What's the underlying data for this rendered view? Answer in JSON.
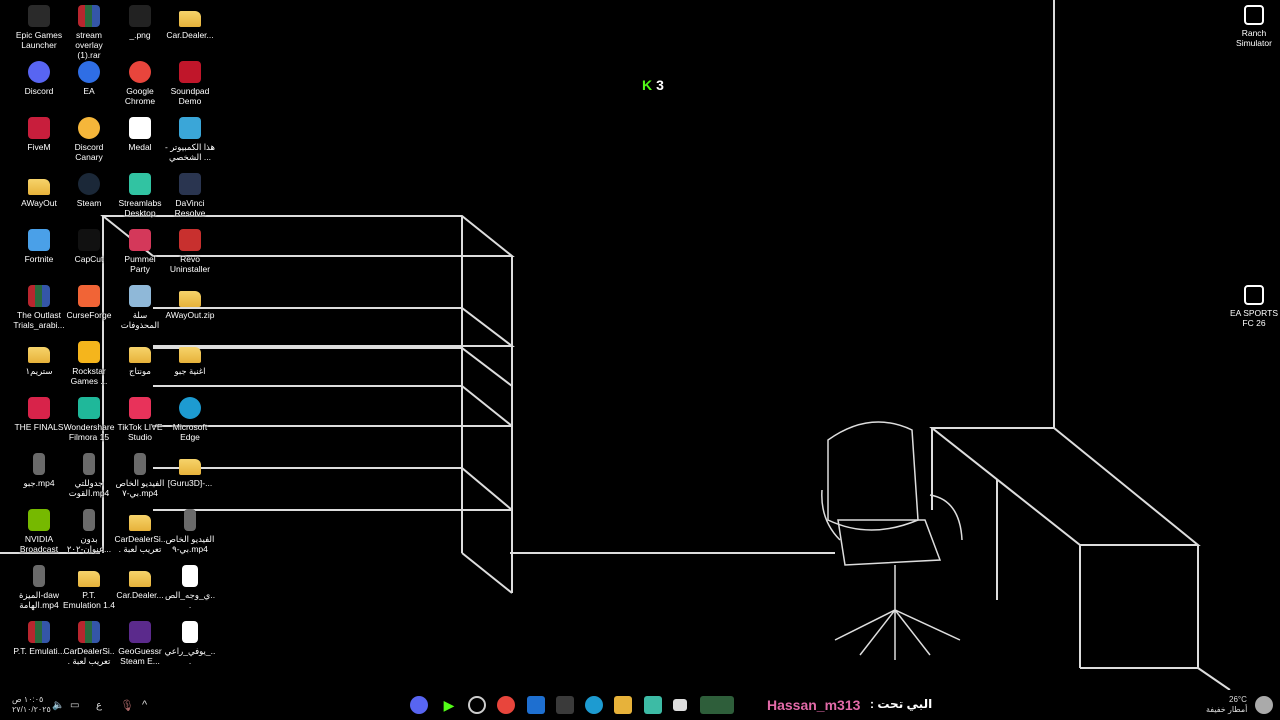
{
  "desktop": {
    "overlay_counter": "3",
    "icons": [
      {
        "label": "Epic Games Launcher",
        "icon": "epic-icon",
        "color": "#2a2a2a"
      },
      {
        "label": "stream overlay (1).rar",
        "icon": "rar-icon"
      },
      {
        "label": "_.png",
        "icon": "image-file-icon",
        "color": "#222"
      },
      {
        "label": "Car.Dealer...",
        "icon": "folder-icon"
      },
      {
        "label": "Discord",
        "icon": "discord-icon",
        "color": "#5865f2"
      },
      {
        "label": "EA",
        "icon": "ea-icon",
        "color": "#2f6ee5"
      },
      {
        "label": "Google Chrome",
        "icon": "chrome-icon",
        "color": "#e8453c"
      },
      {
        "label": "Soundpad Demo",
        "icon": "soundpad-icon",
        "color": "#c0162a"
      },
      {
        "label": "FiveM",
        "icon": "fivem-icon",
        "color": "#c81e3c"
      },
      {
        "label": "Discord Canary",
        "icon": "discord-canary-icon",
        "color": "#f5b63a"
      },
      {
        "label": "Medal",
        "icon": "medal-icon",
        "color": "#ffffff"
      },
      {
        "label": "هذا الكمبيوتر - الشخصي ...",
        "icon": "this-pc-icon",
        "color": "#3aa6d8"
      },
      {
        "label": "AWayOut",
        "icon": "folder-icon"
      },
      {
        "label": "Steam",
        "icon": "steam-icon",
        "color": "#1b2838"
      },
      {
        "label": "Streamlabs Desktop",
        "icon": "streamlabs-icon",
        "color": "#31c3a2"
      },
      {
        "label": "DaVinci Resolve",
        "icon": "davinci-icon",
        "color": "#2a3550"
      },
      {
        "label": "Fortnite",
        "icon": "fortnite-icon",
        "color": "#4aa0e8"
      },
      {
        "label": "CapCut",
        "icon": "capcut-icon",
        "color": "#111111"
      },
      {
        "label": "Pummel Party",
        "icon": "pummel-party-icon",
        "color": "#d4385a"
      },
      {
        "label": "Revo Uninstaller",
        "icon": "revo-icon",
        "color": "#c8302e"
      },
      {
        "label": "The Outlast Trials_arabi...",
        "icon": "rar-icon"
      },
      {
        "label": "CurseForge",
        "icon": "curseforge-icon",
        "color": "#f16436"
      },
      {
        "label": "سلة المحذوفات",
        "icon": "recycle-bin-icon",
        "color": "#8fb8d8"
      },
      {
        "label": "AWayOut.zip",
        "icon": "zip-folder-icon"
      },
      {
        "label": "ستريم١",
        "icon": "folder-icon"
      },
      {
        "label": "Rockstar Games ...",
        "icon": "rockstar-icon",
        "color": "#f5b51c"
      },
      {
        "label": "مونتاج",
        "icon": "folder-icon"
      },
      {
        "label": "اغنية جبو",
        "icon": "folder-icon"
      },
      {
        "label": "THE FINALS",
        "icon": "the-finals-icon",
        "color": "#d8234a"
      },
      {
        "label": "Wondershare Filmora 15",
        "icon": "filmora-icon",
        "color": "#1fb89a"
      },
      {
        "label": "TikTok LIVE Studio",
        "icon": "tiktok-icon",
        "color": "#e8325a"
      },
      {
        "label": "Microsoft Edge",
        "icon": "edge-icon",
        "color": "#1d9bd1"
      },
      {
        "label": "جبو.mp4",
        "icon": "video-file-icon"
      },
      {
        "label": "جدوللتي القوت.mp4",
        "icon": "video-file-icon"
      },
      {
        "label": "الفيديو الخاص بي-٧.mp4",
        "icon": "video-file-icon"
      },
      {
        "label": "[Guru3D]-...",
        "icon": "folder-icon"
      },
      {
        "label": "NVIDIA Broadcast",
        "icon": "nvidia-icon",
        "color": "#76b900"
      },
      {
        "label": "بدون عنوان-٢٠٢...",
        "icon": "video-file-icon"
      },
      {
        "label": "CarDealerSi... تعريب لعبة",
        "icon": "folder-icon"
      },
      {
        "label": "الفيديو الخاص بي-٩.mp4",
        "icon": "video-file-icon"
      },
      {
        "label": "الميزة-daw الهامة.mp4",
        "icon": "video-file-icon"
      },
      {
        "label": "P.T. Emulation 1.4",
        "icon": "folder-icon"
      },
      {
        "label": "Car.Dealer...",
        "icon": "folder-icon"
      },
      {
        "label": "ي_وجه_الص...",
        "icon": "document-icon"
      },
      {
        "label": "P.T. Emulati...",
        "icon": "rar-icon"
      },
      {
        "label": "CarDealerSi... تعريب لعبة",
        "icon": "rar-icon"
      },
      {
        "label": "GeoGuessr Steam E...",
        "icon": "geoguessr-icon",
        "color": "#5b2a8c"
      },
      {
        "label": "يوفي_راعي_...",
        "icon": "document-icon"
      }
    ],
    "right_icons": [
      {
        "label": "Ranch Simulator",
        "icon": "ranch-simulator-icon",
        "color": "#ffffff"
      },
      {
        "label": "EA SPORTS FC 26",
        "icon": "ea-fc-icon",
        "color": "#ffffff"
      }
    ]
  },
  "taskbar": {
    "clock_time": "١٠:٠٥ ص",
    "clock_date": "٢٧/١٠/٢٠٢٥",
    "lang": "ع",
    "chat_user": "Hassan_m313",
    "chat_text": ": البي تحت",
    "weather_temp": "26°C",
    "weather_desc": "أمطار خفيفة"
  }
}
